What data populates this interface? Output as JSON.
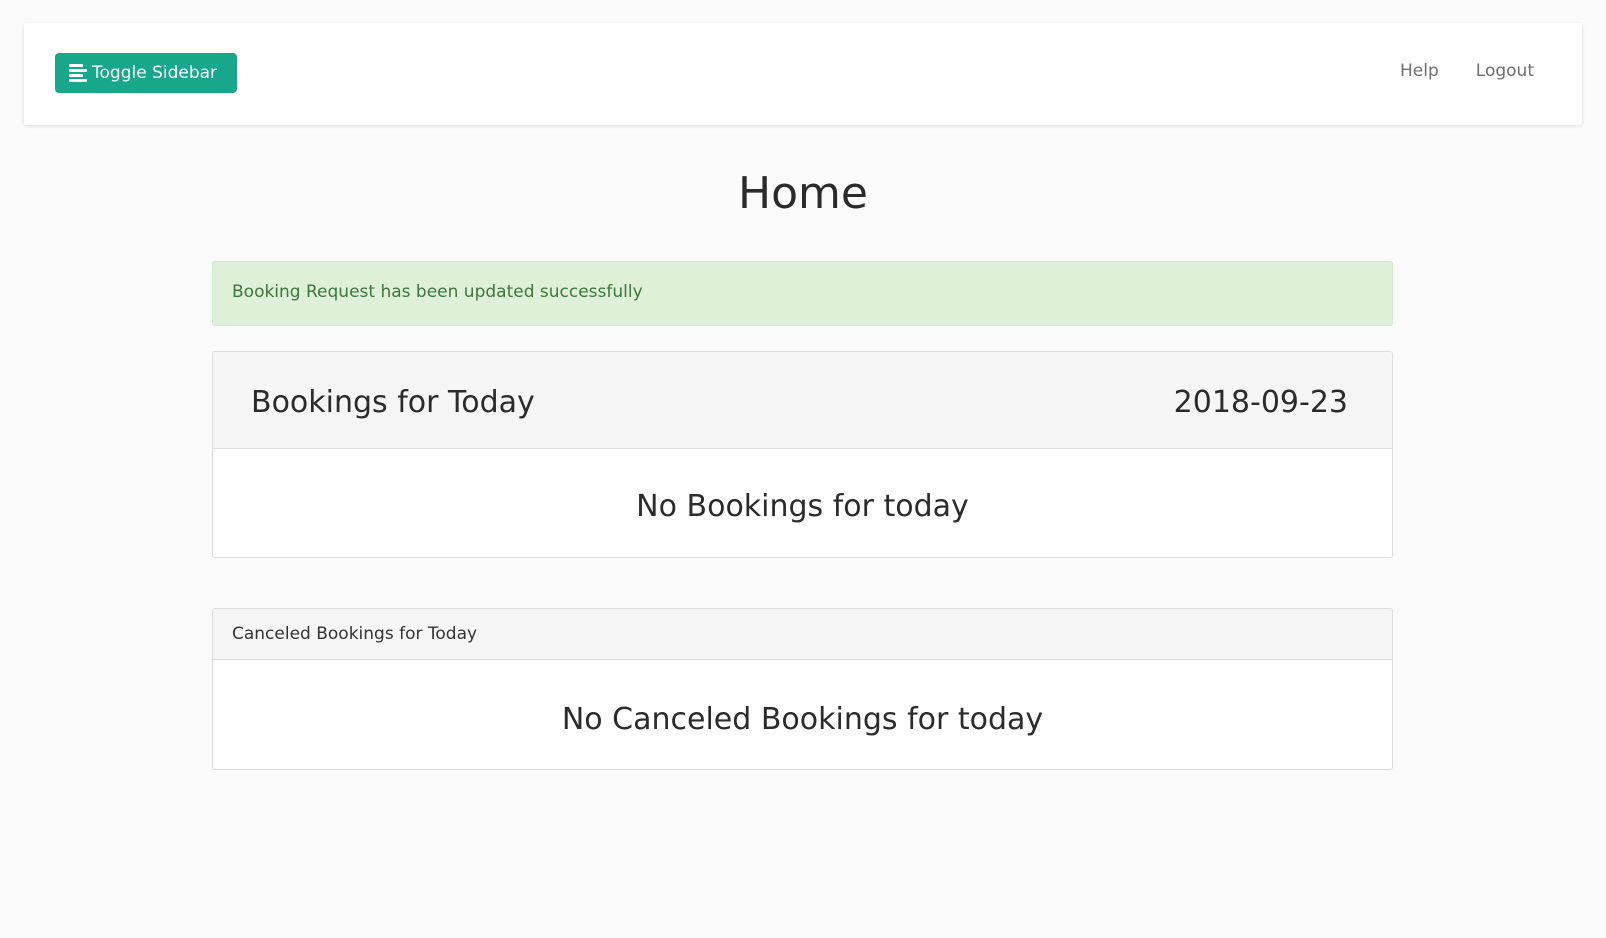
{
  "navbar": {
    "toggle_label": "Toggle Sidebar",
    "toggle_icon": "menu-align-left-icon",
    "links": [
      "Help",
      "Logout"
    ]
  },
  "page": {
    "title": "Home"
  },
  "alert": {
    "message": "Booking Request has been updated successfully"
  },
  "bookings_today": {
    "title": "Bookings for Today",
    "date": "2018-09-23",
    "empty_message": "No Bookings for today"
  },
  "canceled_today": {
    "title": "Canceled Bookings for Today",
    "empty_message": "No Canceled Bookings for today"
  },
  "colors": {
    "accent": "#17a88b",
    "alert_bg": "#dff0d8",
    "alert_text": "#3c763d",
    "page_bg": "#fafafa"
  }
}
